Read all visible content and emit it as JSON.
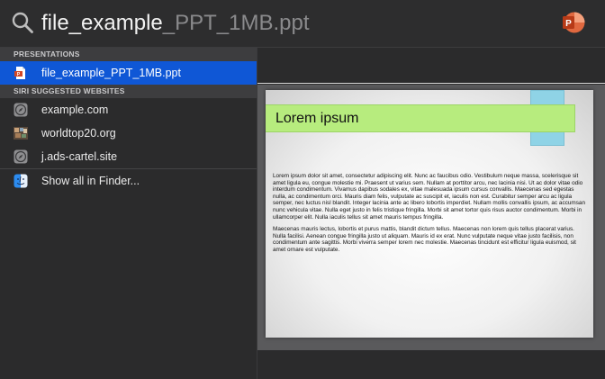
{
  "search": {
    "typed": "file_example",
    "completion": "_PPT_1MB.ppt"
  },
  "sections": {
    "presentations": "PRESENTATIONS",
    "siri_websites": "SIRI SUGGESTED WEBSITES"
  },
  "results": {
    "presentation": "file_example_PPT_1MB.ppt",
    "websites": [
      "example.com",
      "worldtop20.org",
      "j.ads-cartel.site"
    ],
    "show_all": "Show all in Finder..."
  },
  "slide": {
    "title": "Lorem ipsum",
    "paragraphs": [
      "Lorem ipsum dolor sit amet, consectetur adipiscing elit. Nunc ac faucibus odio. Vestibulum neque massa, scelerisque sit amet ligula eu, congue molestie mi. Praesent ut varius sem. Nullam at porttitor arcu, nec lacinia nisi. Ut ac dolor vitae odio interdum condimentum. Vivamus dapibus sodales ex, vitae malesuada ipsum cursus convallis. Maecenas sed egestas nulla, ac condimentum orci. Mauris diam felis, vulputate ac suscipit et, iaculis non est. Curabitur semper arcu ac ligula semper, nec luctus nisl blandit. Integer lacinia ante ac libero lobortis imperdiet. Nullam mollis convallis ipsum, ac accumsan nunc vehicula vitae. Nulla eget justo in felis tristique fringilla. Morbi sit amet tortor quis risus auctor condimentum. Morbi in ullamcorper elit. Nulla iaculis tellus sit amet mauris tempus fringilla.",
      "Maecenas mauris lectus, lobortis et purus mattis, blandit dictum tellus. Maecenas non lorem quis tellus placerat varius. Nulla facilisi. Aenean congue fringilla justo ut aliquam. Mauris id ex erat. Nunc vulputate neque vitae justo facilisis, non condimentum ante sagittis. Morbi viverra semper lorem nec molestie. Maecenas tincidunt est efficitur ligula euismod, sit amet ornare est vulputate."
    ]
  },
  "icons": {
    "search": "search-icon",
    "app": "powerpoint-icon",
    "presentation": "ppt-file-icon",
    "website": "safari-compass-icon",
    "finder": "finder-icon"
  },
  "colors": {
    "selected": "#0f57d6",
    "powerpoint": "#c43e1c",
    "slide_title_bar": "#b7ec7e",
    "slide_tab": "#8fd3e6"
  }
}
